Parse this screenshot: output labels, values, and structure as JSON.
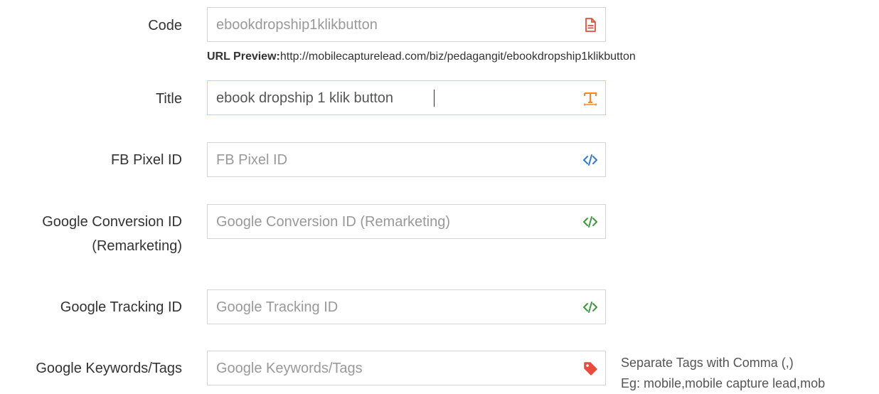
{
  "form": {
    "code": {
      "label": "Code",
      "value": "ebookdropship1klikbutton",
      "icon": "file-pdf-icon",
      "icon_color": "#e74c3c"
    },
    "url_preview": {
      "label": "URL Preview:",
      "url": "http://mobilecapturelead.com/biz/pedagangit/ebookdropship1klikbutton"
    },
    "title": {
      "label": "Title",
      "value": "ebook dropship 1 klik button",
      "icon": "text-height-icon",
      "icon_color": "#f08a24"
    },
    "fb_pixel": {
      "label": "FB Pixel ID",
      "placeholder": "FB Pixel ID",
      "icon": "code-icon",
      "icon_color": "#2e7bcf"
    },
    "google_conversion": {
      "label_line1": "Google Conversion ID",
      "label_line2": "(Remarketing)",
      "placeholder": "Google Conversion ID (Remarketing)",
      "icon": "code-icon",
      "icon_color": "#3c9a3c"
    },
    "google_tracking": {
      "label": "Google Tracking ID",
      "placeholder": "Google Tracking ID",
      "icon": "code-icon",
      "icon_color": "#3c9a3c"
    },
    "google_keywords": {
      "label": "Google Keywords/Tags",
      "placeholder": "Google Keywords/Tags",
      "icon": "tag-icon",
      "icon_color": "#e74c3c",
      "help_line1": "Separate Tags with Comma (,)",
      "help_line2": "Eg: mobile,mobile capture lead,mob"
    }
  }
}
